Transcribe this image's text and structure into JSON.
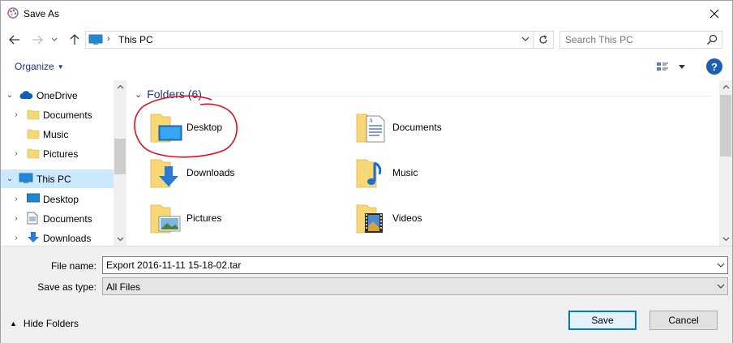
{
  "window": {
    "title": "Save As"
  },
  "address": {
    "crumb": "This PC",
    "search_placeholder": "Search This PC"
  },
  "toolbar": {
    "organize_label": "Organize"
  },
  "nav_pane": {
    "items": [
      {
        "label": "OneDrive",
        "icon": "onedrive-icon",
        "expanded": true
      },
      {
        "label": "Documents",
        "icon": "folder-icon"
      },
      {
        "label": "Music",
        "icon": "folder-icon"
      },
      {
        "label": "Pictures",
        "icon": "folder-icon"
      },
      {
        "label": "This PC",
        "icon": "this-pc-icon",
        "expanded": true,
        "selected": true
      },
      {
        "label": "Desktop",
        "icon": "desktop-icon"
      },
      {
        "label": "Documents",
        "icon": "documents-icon"
      },
      {
        "label": "Downloads",
        "icon": "downloads-icon"
      }
    ]
  },
  "content": {
    "group_header": "Folders (6)",
    "folders": [
      {
        "name": "Desktop",
        "icon": "desktop-folder-icon"
      },
      {
        "name": "Documents",
        "icon": "documents-folder-icon"
      },
      {
        "name": "Downloads",
        "icon": "downloads-folder-icon"
      },
      {
        "name": "Music",
        "icon": "music-folder-icon"
      },
      {
        "name": "Pictures",
        "icon": "pictures-folder-icon"
      },
      {
        "name": "Videos",
        "icon": "videos-folder-icon"
      }
    ]
  },
  "form": {
    "file_name_label": "File name:",
    "file_name_value": "Export 2016-11-11 15-18-02.tar",
    "save_type_label": "Save as type:",
    "save_type_value": "All Files"
  },
  "footer": {
    "hide_folders_label": "Hide Folders",
    "save_label": "Save",
    "cancel_label": "Cancel"
  },
  "colors": {
    "accent": "#0078d7",
    "link_blue": "#1e3287",
    "selection": "#cce8ff",
    "annotation_red": "#e0101a",
    "folder_yellow": "#f8d775"
  }
}
